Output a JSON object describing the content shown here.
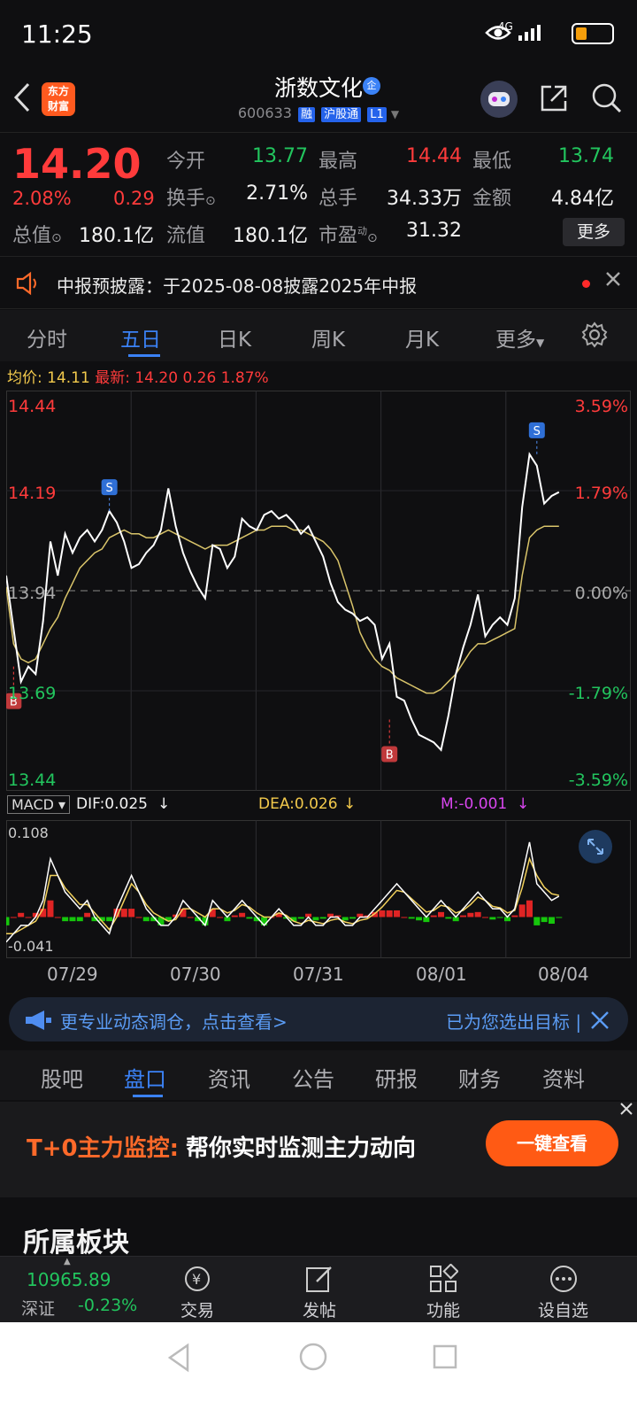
{
  "status_bar": {
    "time": "11:25",
    "network": "4G",
    "battery_level": 0.3
  },
  "header": {
    "logo_text_line1": "东方",
    "logo_text_line2": "财富",
    "stock_name": "浙数文化",
    "badge": "企",
    "code": "600633",
    "tags": [
      "融",
      "沪股通",
      "L1"
    ]
  },
  "quote": {
    "price": "14.20",
    "change_pct": "2.08%",
    "change": "0.29",
    "fields": [
      {
        "label": "今开",
        "value": "13.77",
        "color": "#22c55e"
      },
      {
        "label": "最高",
        "value": "14.44",
        "color": "#ff3b3b"
      },
      {
        "label": "最低",
        "value": "13.74",
        "color": "#22c55e"
      },
      {
        "label": "换手",
        "value": "2.71%",
        "color": "#f2f2f2"
      },
      {
        "label": "总手",
        "value": "34.33万",
        "color": "#f2f2f2"
      },
      {
        "label": "金额",
        "value": "4.84亿",
        "color": "#f2f2f2"
      },
      {
        "label": "总值",
        "value": "180.1亿",
        "color": "#f2f2f2"
      },
      {
        "label": "流值",
        "value": "180.1亿",
        "color": "#f2f2f2"
      },
      {
        "label": "市盈",
        "value": "31.32",
        "color": "#f2f2f2"
      }
    ],
    "pe_superscript": "动",
    "more": "更多"
  },
  "notice": {
    "text": "中报预披露：于2025-08-08披露2025年中报"
  },
  "chart_tabs": [
    "分时",
    "五日",
    "日K",
    "周K",
    "月K",
    "更多"
  ],
  "chart_tabs_active": 1,
  "avg_line": {
    "avg_label": "均价:",
    "avg_value": "14.11",
    "latest_label": "最新:",
    "latest_value": "14.20",
    "latest_change": "0.26",
    "latest_pct": "1.87%"
  },
  "chart_data": [
    {
      "type": "line",
      "title": "",
      "x": [
        "07/29",
        "07/30",
        "07/31",
        "08/01",
        "08/04"
      ],
      "ylim": [
        13.44,
        14.44
      ],
      "y_ticks_left": [
        "14.44",
        "14.19",
        "13.94",
        "13.69",
        "13.44"
      ],
      "y_ticks_right": [
        "3.59%",
        "1.79%",
        "0.00%",
        "-1.79%",
        "-3.59%"
      ],
      "reference_price": 13.94,
      "series": [
        {
          "name": "",
          "color": "#ffffff",
          "values": [
            13.98,
            13.84,
            13.7,
            13.74,
            13.72,
            13.86,
            14.07,
            13.98,
            14.09,
            14.04,
            14.08,
            14.1,
            14.07,
            14.1,
            14.15,
            14.12,
            14.07,
            14.0,
            14.01,
            14.04,
            14.06,
            14.1,
            14.21,
            14.11,
            14.04,
            13.99,
            13.95,
            13.92,
            14.06,
            14.05,
            14.0,
            14.03,
            14.13,
            14.11,
            14.1,
            14.14,
            14.15,
            14.13,
            14.14,
            14.12,
            14.09,
            14.11,
            14.07,
            14.03,
            13.96,
            13.91,
            13.89,
            13.88,
            13.86,
            13.87,
            13.85,
            13.76,
            13.8,
            13.66,
            13.65,
            13.6,
            13.56,
            13.55,
            13.54,
            13.52,
            13.61,
            13.72,
            13.79,
            13.85,
            13.93,
            13.82,
            13.85,
            13.87,
            13.85,
            13.92,
            14.16,
            14.3,
            14.27,
            14.17,
            14.19,
            14.2
          ]
        },
        {
          "name": "",
          "color": "#d9c46a",
          "values": [
            13.95,
            13.8,
            13.76,
            13.75,
            13.76,
            13.8,
            13.84,
            13.87,
            13.92,
            13.96,
            14.0,
            14.02,
            14.04,
            14.05,
            14.08,
            14.09,
            14.1,
            14.09,
            14.09,
            14.08,
            14.08,
            14.09,
            14.1,
            14.09,
            14.08,
            14.07,
            14.06,
            14.05,
            14.06,
            14.06,
            14.06,
            14.07,
            14.08,
            14.09,
            14.1,
            14.1,
            14.11,
            14.11,
            14.11,
            14.1,
            14.1,
            14.09,
            14.08,
            14.07,
            14.05,
            14.02,
            13.96,
            13.9,
            13.83,
            13.79,
            13.76,
            13.74,
            13.73,
            13.71,
            13.7,
            13.69,
            13.68,
            13.67,
            13.67,
            13.68,
            13.7,
            13.72,
            13.75,
            13.78,
            13.8,
            13.8,
            13.81,
            13.82,
            13.83,
            13.84,
            13.98,
            14.08,
            14.1,
            14.11,
            14.11,
            14.11
          ]
        }
      ],
      "markers": [
        {
          "label": "B",
          "x_index": 1,
          "price": 13.74
        },
        {
          "label": "S",
          "x_index": 14,
          "price": 14.15
        },
        {
          "label": "B",
          "x_index": 52,
          "price": 13.6
        },
        {
          "label": "S",
          "x_index": 72,
          "price": 14.3
        }
      ]
    },
    {
      "type": "bar",
      "title": "",
      "ylim": [
        -0.041,
        0.108
      ],
      "y_ticks": [
        "0.108",
        "-0.041"
      ],
      "indicator": "MACD",
      "dif_label": "DIF:0.025",
      "dea_label": "DEA:0.026",
      "m_label": "M:-0.001",
      "series": [
        {
          "name": "DIF",
          "color": "#ffffff",
          "values": [
            -0.03,
            -0.02,
            -0.01,
            -0.01,
            0.0,
            0.02,
            0.07,
            0.05,
            0.03,
            0.02,
            0.01,
            0.02,
            0.0,
            -0.01,
            -0.02,
            0.01,
            0.03,
            0.05,
            0.03,
            0.01,
            0.0,
            -0.01,
            -0.01,
            0.0,
            0.02,
            0.01,
            0.0,
            -0.01,
            0.02,
            0.01,
            0.0,
            0.01,
            0.02,
            0.01,
            0.0,
            -0.01,
            0.0,
            0.01,
            0.0,
            -0.01,
            -0.01,
            0.0,
            -0.01,
            -0.01,
            0.0,
            0.0,
            -0.01,
            -0.01,
            0.0,
            0.0,
            0.01,
            0.02,
            0.03,
            0.04,
            0.03,
            0.02,
            0.01,
            0.0,
            0.01,
            0.02,
            0.01,
            0.0,
            0.01,
            0.02,
            0.03,
            0.02,
            0.01,
            0.01,
            0.0,
            0.01,
            0.05,
            0.09,
            0.04,
            0.03,
            0.02,
            0.025
          ]
        },
        {
          "name": "DEA",
          "color": "#f2d15c",
          "values": [
            -0.02,
            -0.02,
            -0.015,
            -0.01,
            -0.005,
            0.01,
            0.05,
            0.05,
            0.035,
            0.025,
            0.015,
            0.015,
            0.005,
            -0.005,
            -0.015,
            0.0,
            0.02,
            0.04,
            0.03,
            0.015,
            0.005,
            0.0,
            -0.005,
            -0.003,
            0.01,
            0.01,
            0.005,
            0.0,
            0.01,
            0.01,
            0.005,
            0.008,
            0.015,
            0.012,
            0.005,
            0.0,
            0.0,
            0.005,
            0.002,
            -0.005,
            -0.008,
            -0.004,
            -0.006,
            -0.008,
            -0.004,
            -0.002,
            -0.006,
            -0.008,
            -0.004,
            -0.002,
            0.004,
            0.012,
            0.022,
            0.032,
            0.03,
            0.022,
            0.014,
            0.006,
            0.008,
            0.014,
            0.012,
            0.005,
            0.008,
            0.015,
            0.024,
            0.02,
            0.013,
            0.011,
            0.005,
            0.008,
            0.035,
            0.07,
            0.05,
            0.036,
            0.028,
            0.026
          ]
        }
      ],
      "bars": [
        -0.01,
        0.0,
        0.005,
        0.0,
        0.005,
        0.01,
        0.02,
        0.0,
        -0.005,
        -0.005,
        -0.005,
        0.005,
        -0.005,
        -0.005,
        -0.005,
        0.01,
        0.01,
        0.01,
        0.0,
        -0.005,
        -0.005,
        -0.01,
        -0.005,
        0.003,
        0.01,
        0.0,
        -0.005,
        -0.01,
        0.01,
        0.0,
        -0.005,
        0.002,
        0.005,
        -0.002,
        -0.005,
        -0.01,
        0.0,
        0.005,
        -0.002,
        -0.005,
        -0.002,
        0.004,
        -0.004,
        -0.002,
        0.004,
        0.002,
        -0.004,
        -0.002,
        0.004,
        0.002,
        0.006,
        0.008,
        0.008,
        0.008,
        0.0,
        -0.002,
        -0.004,
        -0.006,
        0.002,
        0.006,
        -0.002,
        -0.005,
        0.002,
        0.005,
        0.006,
        0.0,
        -0.003,
        -0.001,
        -0.005,
        0.002,
        0.015,
        0.02,
        -0.01,
        -0.006,
        -0.008,
        -0.001
      ]
    }
  ],
  "promo": {
    "left": "更专业动态调仓，点击查看>",
    "right": "已为您选出目标 |"
  },
  "section_tabs": [
    "股吧",
    "盘口",
    "资讯",
    "公告",
    "研报",
    "财务",
    "资料"
  ],
  "section_tabs_active": 1,
  "ad": {
    "title_highlight": "T+0主力监控:",
    "title": "帮你实时监测主力动向",
    "button": "一键查看"
  },
  "board": {
    "title": "所属板块"
  },
  "bottom_bar": {
    "index_value": "10965.89",
    "index_name": "深证",
    "index_pct": "-0.23%",
    "items": [
      "交易",
      "发帖",
      "功能",
      "设自选"
    ]
  }
}
